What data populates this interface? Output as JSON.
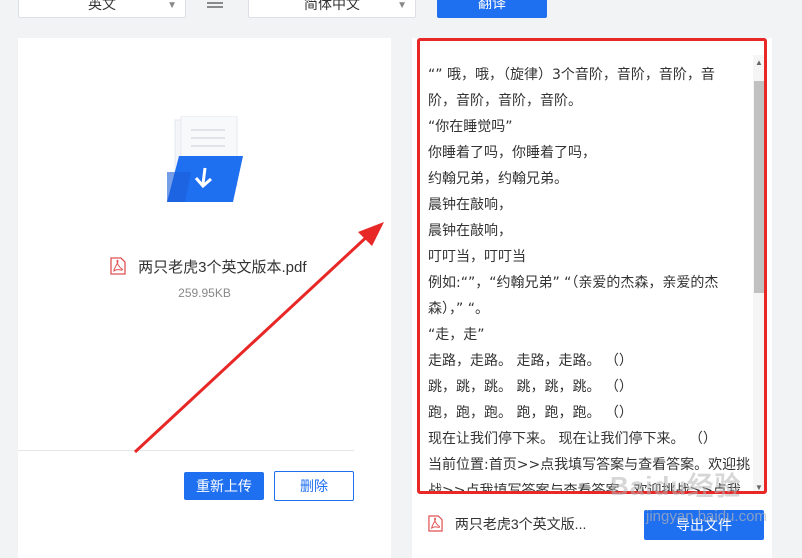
{
  "toolbar": {
    "source_lang": "英文",
    "target_lang": "简体中文",
    "translate_label": "翻译"
  },
  "left": {
    "file_name": "两只老虎3个英文版本.pdf",
    "file_size": "259.95KB",
    "reupload_label": "重新上传",
    "delete_label": "删除"
  },
  "right": {
    "lines": [
      "“” 哦，哦，（旋律）3个音阶，音阶，音阶，音",
      "阶，音阶，音阶，音阶。",
      "“你在睡觉吗”",
      "你睡着了吗，你睡着了吗，",
      "约翰兄弟，约翰兄弟。",
      "晨钟在敲响，",
      "晨钟在敲响，",
      "叮叮当，叮叮当",
      "例如:“”，“约翰兄弟” “（亲爱的杰森，亲爱的杰",
      "森），” “。",
      "“走，走”",
      "走路，走路。 走路，走路。 （）",
      "跳，跳，跳。 跳，跳，跳。 （）",
      "跑，跑，跑。 跑，跑，跑。 （）",
      "现在让我们停下来。 现在让我们停下来。 （）",
      "当前位置:首页>>点我填写答案与查看答案。欢迎挑",
      "战>>点我填写答案与查看答案。欢迎挑战>>点我填"
    ],
    "result_file_name": "两只老虎3个英文版...",
    "export_label": "导出文件"
  },
  "watermark": {
    "text": "Baidu经验",
    "sub": "jingyan.baidu.com"
  },
  "colors": {
    "accent": "#1f6ff1",
    "highlight": "#e82727"
  }
}
